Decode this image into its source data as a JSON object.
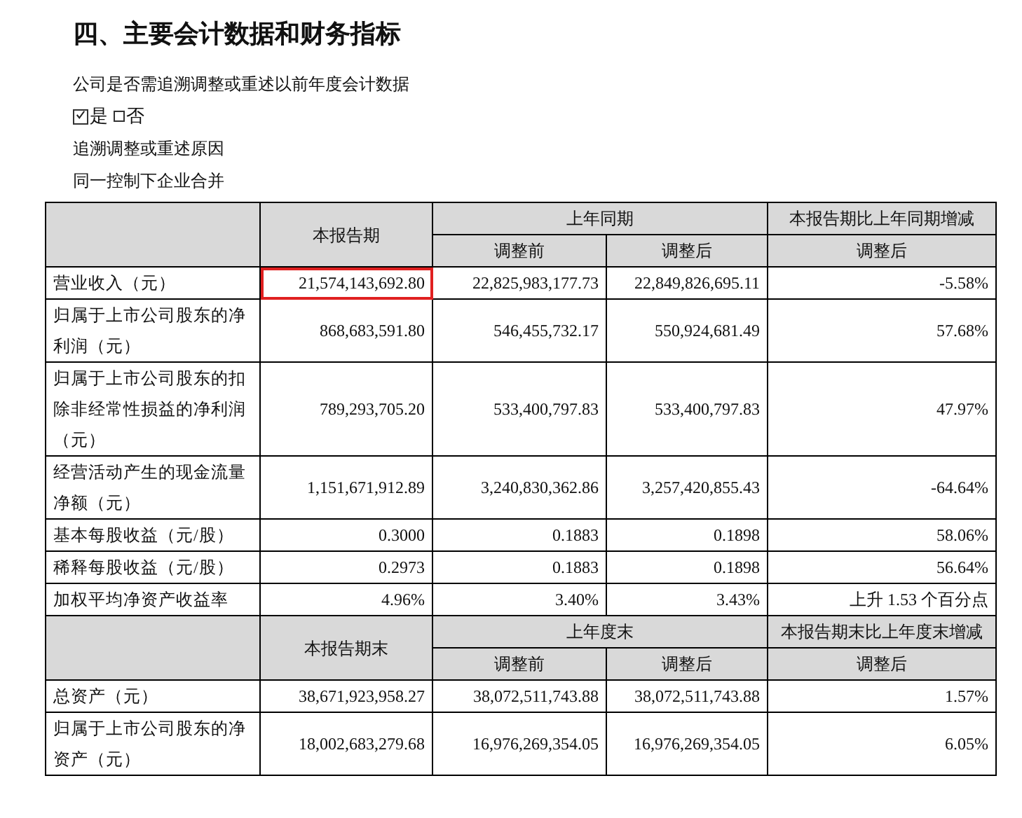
{
  "title": "四、主要会计数据和财务指标",
  "question": "公司是否需追溯调整或重述以前年度会计数据",
  "options": [
    {
      "label": "是",
      "checked": true
    },
    {
      "label": "否",
      "checked": false
    }
  ],
  "notes": [
    "追溯调整或重述原因",
    "同一控制下企业合并"
  ],
  "sections": [
    {
      "header": {
        "current": "本报告期",
        "prior": "上年同期",
        "change": "本报告期比上年同期增减",
        "sub": [
          "调整前",
          "调整后",
          "调整后"
        ]
      },
      "rows": [
        {
          "label": "营业收入（元）",
          "highlighted": true,
          "values": [
            "21,574,143,692.80",
            "22,825,983,177.73",
            "22,849,826,695.11",
            "-5.58%"
          ]
        },
        {
          "label": "归属于上市公司股东的净利润（元）",
          "highlighted": false,
          "values": [
            "868,683,591.80",
            "546,455,732.17",
            "550,924,681.49",
            "57.68%"
          ]
        },
        {
          "label": "归属于上市公司股东的扣除非经常性损益的净利润（元）",
          "highlighted": false,
          "values": [
            "789,293,705.20",
            "533,400,797.83",
            "533,400,797.83",
            "47.97%"
          ]
        },
        {
          "label": "经营活动产生的现金流量净额（元）",
          "highlighted": false,
          "values": [
            "1,151,671,912.89",
            "3,240,830,362.86",
            "3,257,420,855.43",
            "-64.64%"
          ]
        },
        {
          "label": "基本每股收益（元/股）",
          "highlighted": false,
          "values": [
            "0.3000",
            "0.1883",
            "0.1898",
            "58.06%"
          ]
        },
        {
          "label": "稀释每股收益（元/股）",
          "highlighted": false,
          "values": [
            "0.2973",
            "0.1883",
            "0.1898",
            "56.64%"
          ]
        },
        {
          "label": "加权平均净资产收益率",
          "highlighted": false,
          "values": [
            "4.96%",
            "3.40%",
            "3.43%",
            "上升 1.53 个百分点"
          ]
        }
      ]
    },
    {
      "header": {
        "current": "本报告期末",
        "prior": "上年度末",
        "change": "本报告期末比上年度末增减",
        "sub": [
          "调整前",
          "调整后",
          "调整后"
        ]
      },
      "rows": [
        {
          "label": "总资产（元）",
          "highlighted": false,
          "values": [
            "38,671,923,958.27",
            "38,072,511,743.88",
            "38,072,511,743.88",
            "1.57%"
          ]
        },
        {
          "label": "归属于上市公司股东的净资产（元）",
          "highlighted": false,
          "values": [
            "18,002,683,279.68",
            "16,976,269,354.05",
            "16,976,269,354.05",
            "6.05%"
          ]
        }
      ]
    }
  ]
}
